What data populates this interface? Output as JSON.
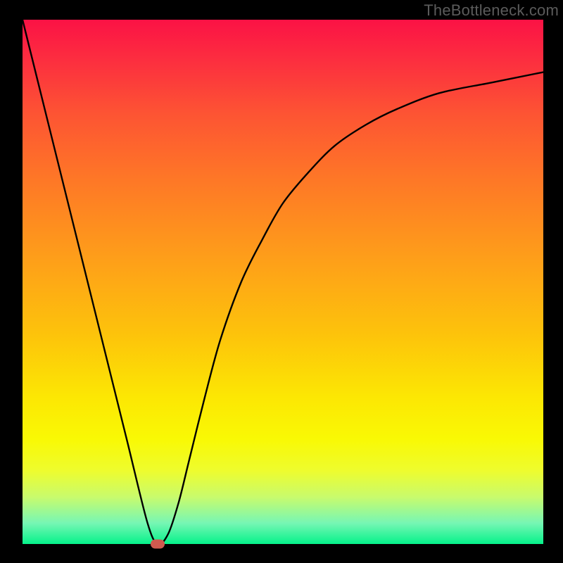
{
  "watermark": "TheBottleneck.com",
  "chart_data": {
    "type": "line",
    "title": "",
    "xlabel": "",
    "ylabel": "",
    "xlim": [
      0,
      100
    ],
    "ylim": [
      0,
      100
    ],
    "background_gradient": {
      "top": "#fb1245",
      "middle": "#fdc30b",
      "bottom": "#05f28a"
    },
    "series": [
      {
        "name": "bottleneck-curve",
        "x": [
          0,
          5,
          10,
          15,
          20,
          24,
          26,
          28,
          30,
          32,
          35,
          38,
          42,
          46,
          50,
          55,
          60,
          66,
          72,
          80,
          90,
          100
        ],
        "values": [
          100,
          80,
          60,
          40,
          20,
          4,
          0,
          2,
          8,
          16,
          28,
          39,
          50,
          58,
          65,
          71,
          76,
          80,
          83,
          86,
          88,
          90
        ]
      }
    ],
    "annotations": [
      {
        "name": "minimum-marker",
        "x": 26,
        "y": 0,
        "color": "#d05a4f"
      }
    ]
  }
}
